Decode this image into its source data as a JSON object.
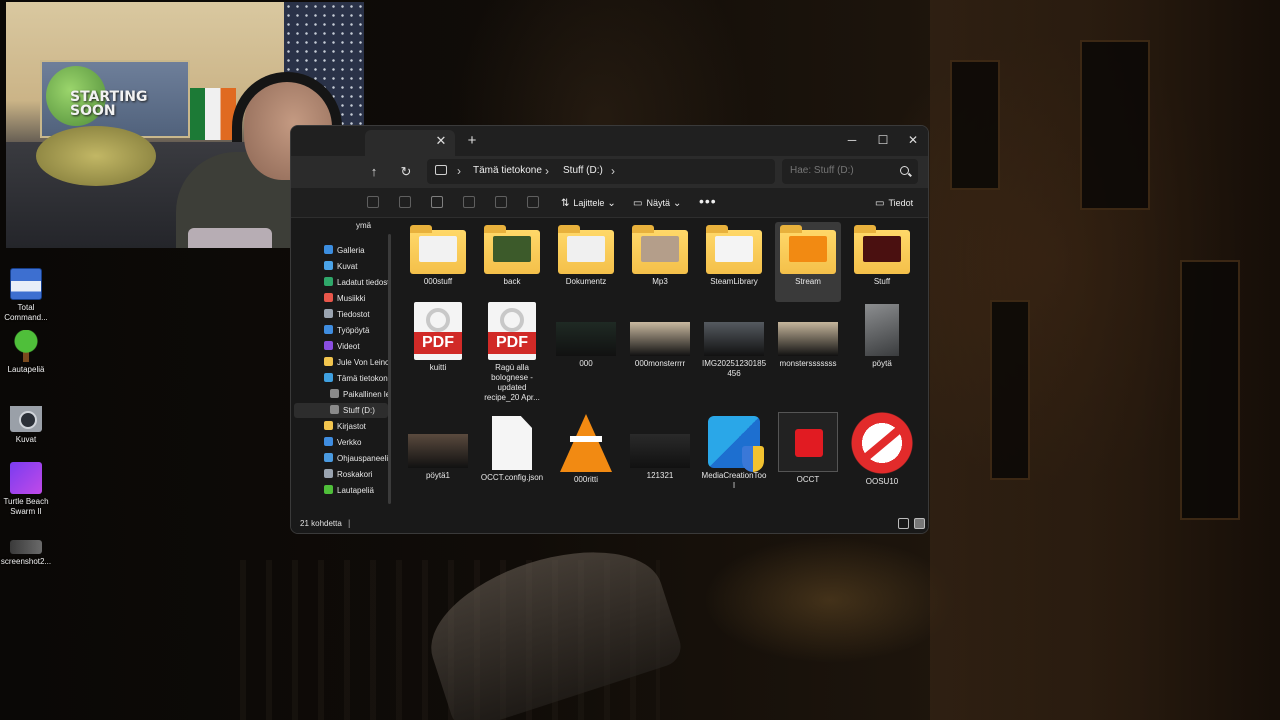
{
  "webcam": {
    "poster_text": "STARTING SOON"
  },
  "desktop": {
    "icons": [
      {
        "label": "Total Command...",
        "icon": "floppy-icon"
      },
      {
        "label": "Lautapeliä",
        "icon": "tree-icon"
      },
      {
        "label": "Kuvat",
        "icon": "camera-icon"
      },
      {
        "label": "Turtle Beach Swarm II",
        "icon": "turtle-beach-icon"
      },
      {
        "label": "screenshot2...",
        "icon": "image-file-icon"
      }
    ]
  },
  "explorer": {
    "tab": {
      "close_glyph": "✕",
      "add_glyph": "+"
    },
    "window_controls": {
      "minimize": "─",
      "maximize": "☐",
      "close": "✕"
    },
    "nav": {
      "up_glyph": "↑",
      "refresh_glyph": "↻"
    },
    "address": {
      "crumbs": [
        "Tämä tietokone",
        "Stuff (D:)"
      ],
      "sep": "›"
    },
    "search": {
      "placeholder": "Hae: Stuff (D:)"
    },
    "toolbar": {
      "sort_label": "Lajittele",
      "view_label": "Näytä",
      "more": "•••",
      "details_label": "Tiedot"
    },
    "sidebar": {
      "items": [
        {
          "label": "ymä",
          "color": "#6b6b6b"
        },
        {
          "label": "Galleria",
          "color": "#3c8ee0"
        },
        {
          "label": "Kuvat",
          "color": "#4aa3e8"
        },
        {
          "label": "Ladatut tiedostot",
          "color": "#2fa86a"
        },
        {
          "label": "Musiikki",
          "color": "#e8564a"
        },
        {
          "label": "Tiedostot",
          "color": "#9aa4b0"
        },
        {
          "label": "Työpöytä",
          "color": "#3f8de0"
        },
        {
          "label": "Videot",
          "color": "#8a4ee0"
        },
        {
          "label": "Jule Von Leinone",
          "color": "#f2c54e"
        },
        {
          "label": "Tämä tietokone",
          "color": "#3fa0e0"
        },
        {
          "label": "Paikallinen levy",
          "color": "#8a8a8a"
        },
        {
          "label": "Stuff (D:)",
          "color": "#8a8a8a"
        },
        {
          "label": "Kirjastot",
          "color": "#f2c54e"
        },
        {
          "label": "Verkko",
          "color": "#3f8de0"
        },
        {
          "label": "Ohjauspaneeli",
          "color": "#4a9ae0"
        },
        {
          "label": "Roskakori",
          "color": "#9aa4b0"
        },
        {
          "label": "Lautapeliä",
          "color": "#4fbf3a"
        }
      ]
    },
    "files": [
      {
        "name": "000stuff",
        "kind": "folder",
        "inner": "#f2f2f2"
      },
      {
        "name": "back",
        "kind": "folder",
        "inner": "#3c5a2a"
      },
      {
        "name": "Dokumentz",
        "kind": "folder",
        "inner": "#f0f0f0"
      },
      {
        "name": "Mp3",
        "kind": "folder",
        "inner": "#b49e8a"
      },
      {
        "name": "SteamLibrary",
        "kind": "folder",
        "inner": "#f4f4f4"
      },
      {
        "name": "Stream",
        "kind": "folder",
        "inner": "#f28a12"
      },
      {
        "name": "Stuff",
        "kind": "folder",
        "inner": "#4a1010"
      },
      {
        "name": "kuitti",
        "kind": "pdf"
      },
      {
        "name": "Ragù alla bolognese - updated recipe_20 Apr...",
        "kind": "pdf"
      },
      {
        "name": "000",
        "kind": "photo",
        "color": "#1f2a24"
      },
      {
        "name": "000monsterrrr",
        "kind": "photo",
        "color": "#c9b9a0"
      },
      {
        "name": "IMG20251230185456",
        "kind": "photo",
        "color": "#555a60"
      },
      {
        "name": "monstersssssss",
        "kind": "photo",
        "color": "#c6b69c"
      },
      {
        "name": "pöytä",
        "kind": "photo-tall",
        "color": "#8c8e90"
      },
      {
        "name": "pöytä1",
        "kind": "photo",
        "color": "#5a4a3e"
      },
      {
        "name": "OCCT.config.json",
        "kind": "doc"
      },
      {
        "name": "000ritti",
        "kind": "vlc"
      },
      {
        "name": "121321",
        "kind": "photo",
        "color": "#2a2a2a"
      },
      {
        "name": "MediaCreationTool",
        "kind": "media-tool"
      },
      {
        "name": "OCCT",
        "kind": "occt"
      },
      {
        "name": "OOSU10",
        "kind": "oosu"
      }
    ],
    "selected_file": "Stream",
    "status": {
      "count_text": "21 kohdetta"
    }
  }
}
